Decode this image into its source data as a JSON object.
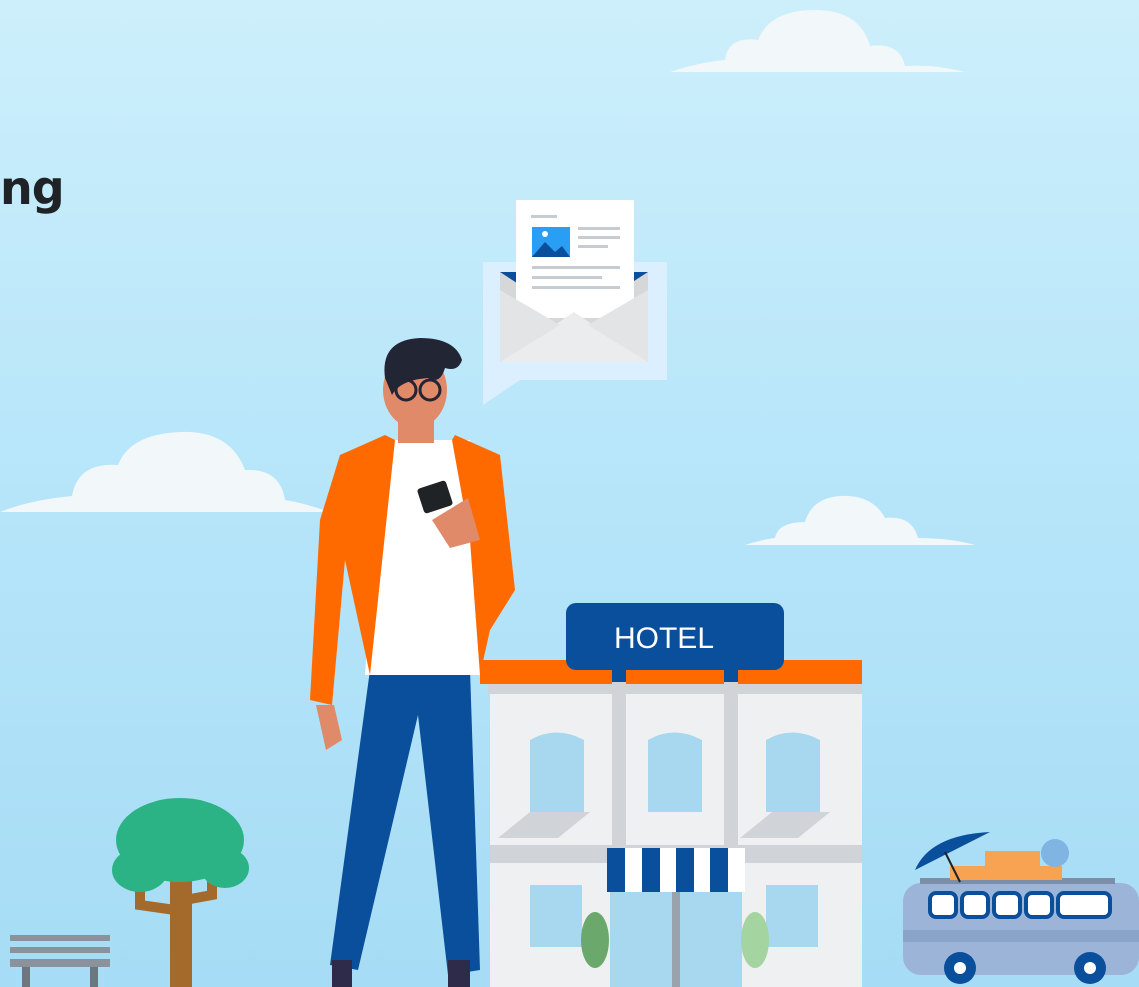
{
  "heading": {
    "text": "ng"
  },
  "hotel": {
    "sign": "HOTEL"
  },
  "colors": {
    "sky": "#bfe8fa",
    "cloud": "#f2f7fa",
    "jacket": "#ff6a00",
    "jeans": "#0a4f9c",
    "hotel_sign": "#0a4f9c",
    "hotel_roof": "#ff6a00",
    "tree": "#2bb386",
    "van": "#9db4d9"
  },
  "icons": [
    "cloud-icon",
    "envelope-icon",
    "smartphone-icon",
    "bench-icon",
    "tree-icon",
    "van-icon",
    "umbrella-icon",
    "luggage-icon"
  ]
}
